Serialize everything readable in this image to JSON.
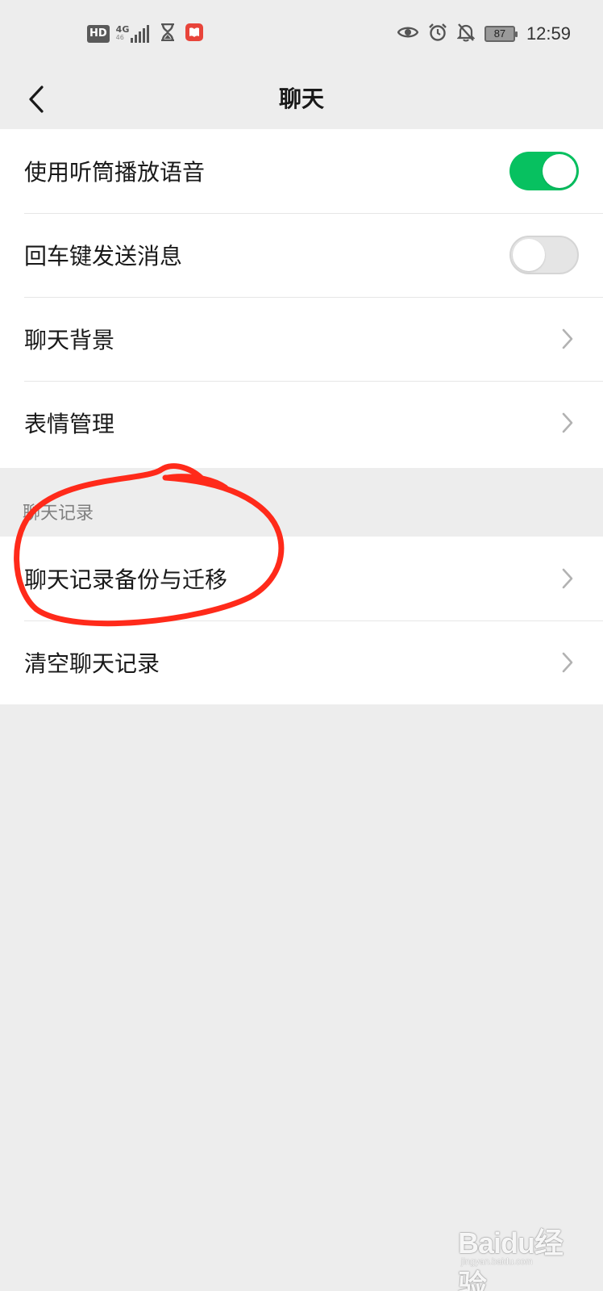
{
  "status_bar": {
    "hd": "HD",
    "network": "4G",
    "network_sub": "46",
    "battery": "87",
    "time": "12:59",
    "icons_left": [
      "hd-badge",
      "signal-icon",
      "hourglass-icon",
      "book-app-icon"
    ],
    "icons_right": [
      "eye-icon",
      "alarm-icon",
      "mute-bell-icon",
      "battery-icon"
    ]
  },
  "nav": {
    "title": "聊天",
    "back_icon": "chevron-left-icon"
  },
  "settings": {
    "group1": [
      {
        "label": "使用听筒播放语音",
        "control": "toggle",
        "on": true
      },
      {
        "label": "回车键发送消息",
        "control": "toggle",
        "on": false
      },
      {
        "label": "聊天背景",
        "control": "chevron"
      },
      {
        "label": "表情管理",
        "control": "chevron"
      }
    ],
    "section_header": "聊天记录",
    "group2": [
      {
        "label": "聊天记录备份与迁移",
        "control": "chevron"
      },
      {
        "label": "清空聊天记录",
        "control": "chevron"
      }
    ]
  },
  "colors": {
    "toggle_on": "#07c160",
    "toggle_off": "#e5e5e5",
    "background": "#ededed",
    "annotation": "#ff2a1a"
  },
  "watermark": {
    "brand": "Baidu经验",
    "sub": "jingyan.baidu.com"
  }
}
